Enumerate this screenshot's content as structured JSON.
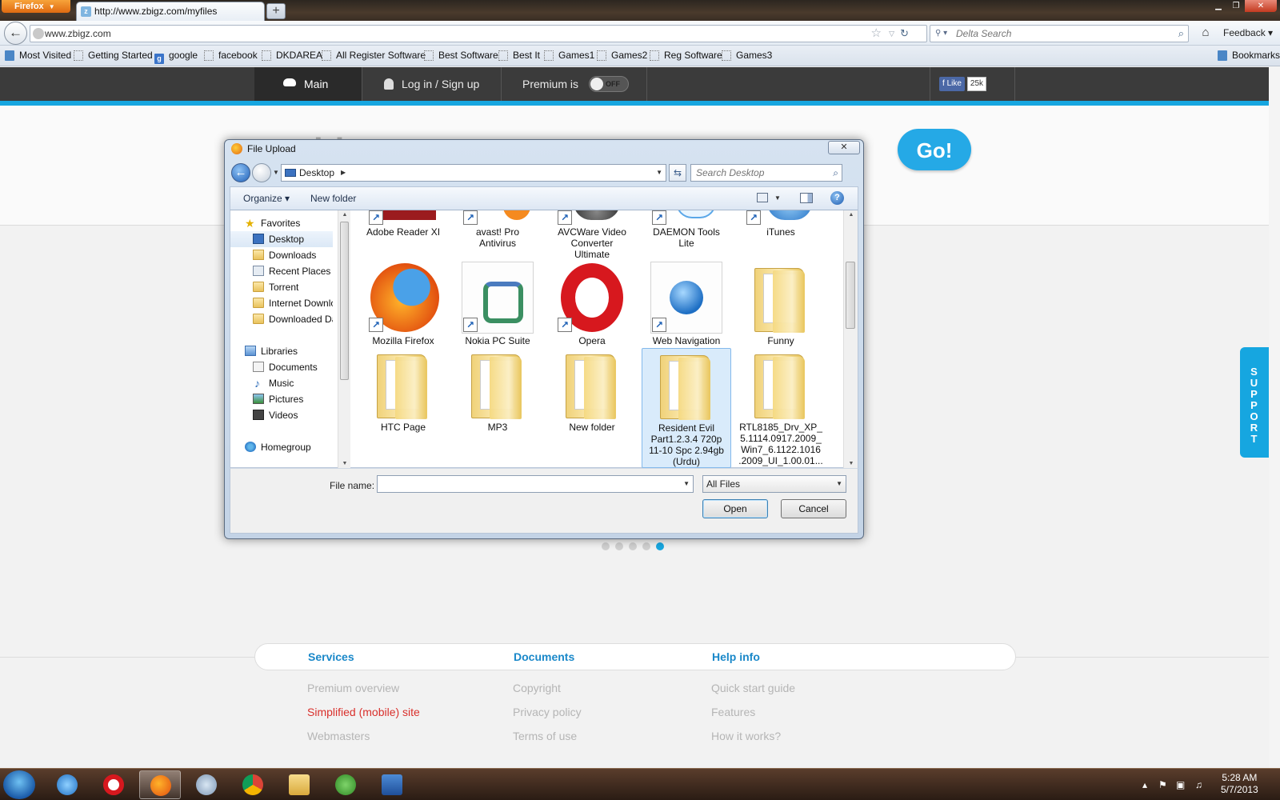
{
  "browser": {
    "menu_label": "Firefox",
    "tab_title": "http://www.zbigz.com/myfiles",
    "url": "www.zbigz.com",
    "search_placeholder": "Delta Search",
    "feedback_label": "Feedback",
    "bookmarks_label": "Bookmarks",
    "bookmarks_bar": [
      "Most Visited",
      "Getting Started",
      "google",
      "facebook",
      "DKDAREA",
      "All Register Software",
      "Best Software",
      "Best It",
      "Games1",
      "Games2",
      "Reg Software",
      "Games3"
    ]
  },
  "site": {
    "nav": {
      "main": "Main",
      "login": "Log in / Sign up",
      "premium": "Premium is",
      "premium_toggle": "OFF",
      "fb_like": "Like",
      "fb_count": "25k"
    },
    "logo_text": "zbigz",
    "go_label": "Go!",
    "support_label": "SUPPORT",
    "footer": {
      "columns": [
        {
          "heading": "Services",
          "links": [
            "Premium overview",
            "Simplified (mobile) site",
            "Webmasters"
          ]
        },
        {
          "heading": "Documents",
          "links": [
            "Copyright",
            "Privacy policy",
            "Terms of use"
          ]
        },
        {
          "heading": "Help info",
          "links": [
            "Quick start guide",
            "Features",
            "How it works?"
          ]
        }
      ]
    }
  },
  "dialog": {
    "title": "File Upload",
    "location": "Desktop",
    "search_placeholder": "Search Desktop",
    "toolbar": {
      "organize": "Organize",
      "new_folder": "New folder"
    },
    "nav_pane": {
      "favorites_header": "Favorites",
      "favorites": [
        "Desktop",
        "Downloads",
        "Recent Places",
        "Torrent",
        "Internet Downloa",
        "Downloaded Dat"
      ],
      "libraries_header": "Libraries",
      "libraries": [
        "Documents",
        "Music",
        "Pictures",
        "Videos"
      ],
      "homegroup": "Homegroup"
    },
    "files_row1": [
      {
        "lines": [
          "Adobe Reader XI"
        ]
      },
      {
        "lines": [
          "avast! Pro",
          "Antivirus"
        ]
      },
      {
        "lines": [
          "AVCWare Video",
          "Converter",
          "Ultimate"
        ]
      },
      {
        "lines": [
          "DAEMON Tools",
          "Lite"
        ]
      },
      {
        "lines": [
          "iTunes"
        ]
      }
    ],
    "files_row2": [
      {
        "lines": [
          "Mozilla Firefox"
        ]
      },
      {
        "lines": [
          "Nokia PC Suite"
        ]
      },
      {
        "lines": [
          "Opera"
        ]
      },
      {
        "lines": [
          "Web Navigation"
        ]
      },
      {
        "lines": [
          "Funny"
        ]
      }
    ],
    "files_row3": [
      {
        "lines": [
          "HTC Page"
        ]
      },
      {
        "lines": [
          "MP3"
        ]
      },
      {
        "lines": [
          "New folder"
        ]
      },
      {
        "lines": [
          "Resident Evil",
          "Part1.2.3.4 720p",
          "11-10 Spc 2.94gb",
          "(Urdu)"
        ]
      },
      {
        "lines": [
          "RTL8185_Drv_XP_",
          "5.1114.0917.2009_",
          "Win7_6.1122.1016",
          ".2009_UI_1.00.01..."
        ]
      }
    ],
    "file_name_label": "File name:",
    "file_name_value": "",
    "file_type": "All Files",
    "open_label": "Open",
    "cancel_label": "Cancel"
  },
  "taskbar": {
    "time": "5:28 AM",
    "date": "5/7/2013"
  }
}
